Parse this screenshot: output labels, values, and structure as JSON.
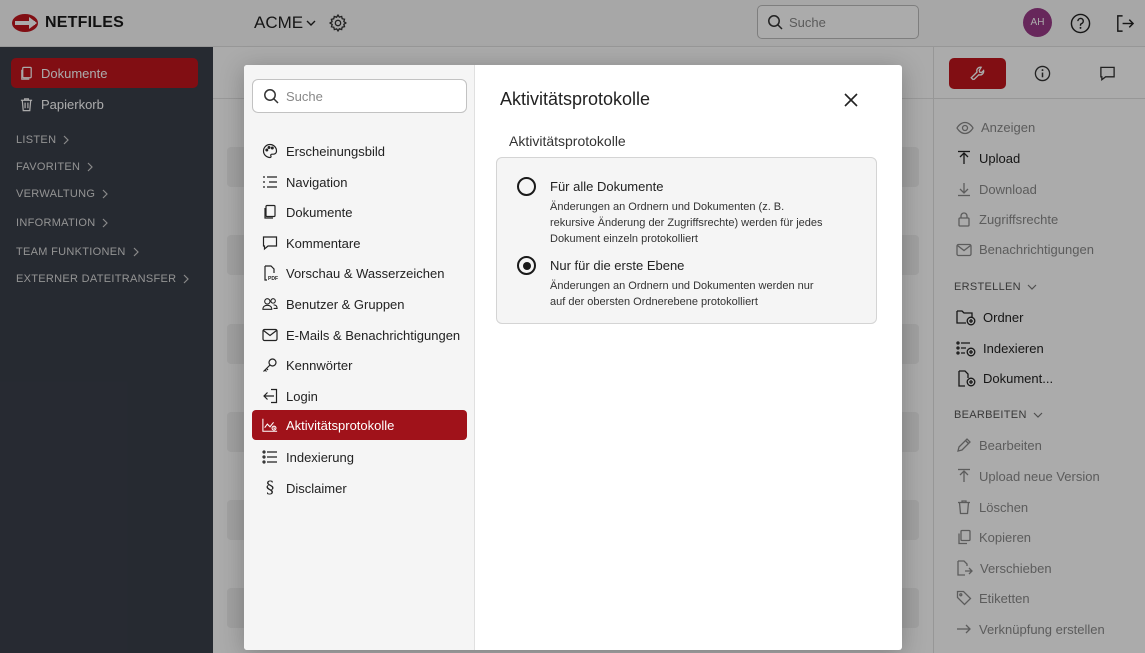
{
  "app": {
    "logo_text": "NETFILES",
    "tenant": "ACME",
    "search_placeholder": "Suche",
    "avatar_initials": "AH",
    "colors": {
      "accent": "#c0151d",
      "sidebar": "#3a3f4a",
      "avatar": "#9a3b88"
    }
  },
  "sidebar": {
    "items": [
      {
        "label": "Dokumente",
        "icon": "documents-icon",
        "active": true
      },
      {
        "label": "Papierkorb",
        "icon": "trash-icon",
        "active": false
      }
    ],
    "sections": [
      "LISTEN",
      "FAVORITEN",
      "VERWALTUNG",
      "INFORMATION",
      "TEAM FUNKTIONEN",
      "EXTERNER DATEITRANSFER"
    ]
  },
  "right_panel": {
    "tabs": [
      "wrench-icon",
      "info-icon",
      "comment-icon"
    ],
    "actions_view": [
      {
        "label": "Anzeigen",
        "icon": "eye-icon",
        "enabled": false
      },
      {
        "label": "Upload",
        "icon": "upload-icon",
        "enabled": true
      },
      {
        "label": "Download",
        "icon": "download-icon",
        "enabled": false
      },
      {
        "label": "Zugriffsrechte",
        "icon": "lock-icon",
        "enabled": false
      },
      {
        "label": "Benachrichtigungen",
        "icon": "mail-icon",
        "enabled": false
      }
    ],
    "section_create": "ERSTELLEN",
    "actions_create": [
      {
        "label": "Ordner",
        "icon": "folder-plus-icon",
        "enabled": true
      },
      {
        "label": "Indexieren",
        "icon": "index-plus-icon",
        "enabled": true
      },
      {
        "label": "Dokument...",
        "icon": "document-plus-icon",
        "enabled": true
      }
    ],
    "section_edit": "BEARBEITEN",
    "actions_edit": [
      {
        "label": "Bearbeiten",
        "icon": "pencil-icon",
        "enabled": false
      },
      {
        "label": "Upload neue Version",
        "icon": "upload-icon",
        "enabled": false
      },
      {
        "label": "Löschen",
        "icon": "trash-icon",
        "enabled": false
      },
      {
        "label": "Kopieren",
        "icon": "copy-icon",
        "enabled": false
      },
      {
        "label": "Verschieben",
        "icon": "move-icon",
        "enabled": false
      },
      {
        "label": "Etiketten",
        "icon": "tag-icon",
        "enabled": false
      },
      {
        "label": "Verknüpfung erstellen",
        "icon": "link-arrow-icon",
        "enabled": false
      }
    ]
  },
  "modal": {
    "search_placeholder": "Suche",
    "nav": [
      {
        "label": "Erscheinungsbild",
        "icon": "palette-icon",
        "active": false
      },
      {
        "label": "Navigation",
        "icon": "navigation-list-icon",
        "active": false
      },
      {
        "label": "Dokumente",
        "icon": "documents-icon",
        "active": false
      },
      {
        "label": "Kommentare",
        "icon": "comment-icon",
        "active": false
      },
      {
        "label": "Vorschau & Wasserzeichen",
        "icon": "pdf-icon",
        "active": false
      },
      {
        "label": "Benutzer & Gruppen",
        "icon": "users-icon",
        "active": false
      },
      {
        "label": "E-Mails & Benachrichtigungen",
        "icon": "mail-icon",
        "active": false
      },
      {
        "label": "Kennwörter",
        "icon": "key-icon",
        "active": false
      },
      {
        "label": "Login",
        "icon": "login-icon",
        "active": false
      },
      {
        "label": "Aktivitätsprotokolle",
        "icon": "activity-log-icon",
        "active": true
      },
      {
        "label": "Indexierung",
        "icon": "list-icon",
        "active": false
      },
      {
        "label": "Disclaimer",
        "icon": "paragraph-icon",
        "active": false
      }
    ],
    "title": "Aktivitätsprotokolle",
    "subtitle": "Aktivitätsprotokolle",
    "options": [
      {
        "label": "Für alle Dokumente",
        "description": "Änderungen an Ordnern und Dokumenten (z. B. rekursive Änderung der Zugriffsrechte) werden für jedes Dokument einzeln protokolliert",
        "checked": false
      },
      {
        "label": "Nur für die erste Ebene",
        "description": "Änderungen an Ordnern und Dokumenten werden nur auf der obersten Ordnerebene protokolliert",
        "checked": true
      }
    ]
  }
}
